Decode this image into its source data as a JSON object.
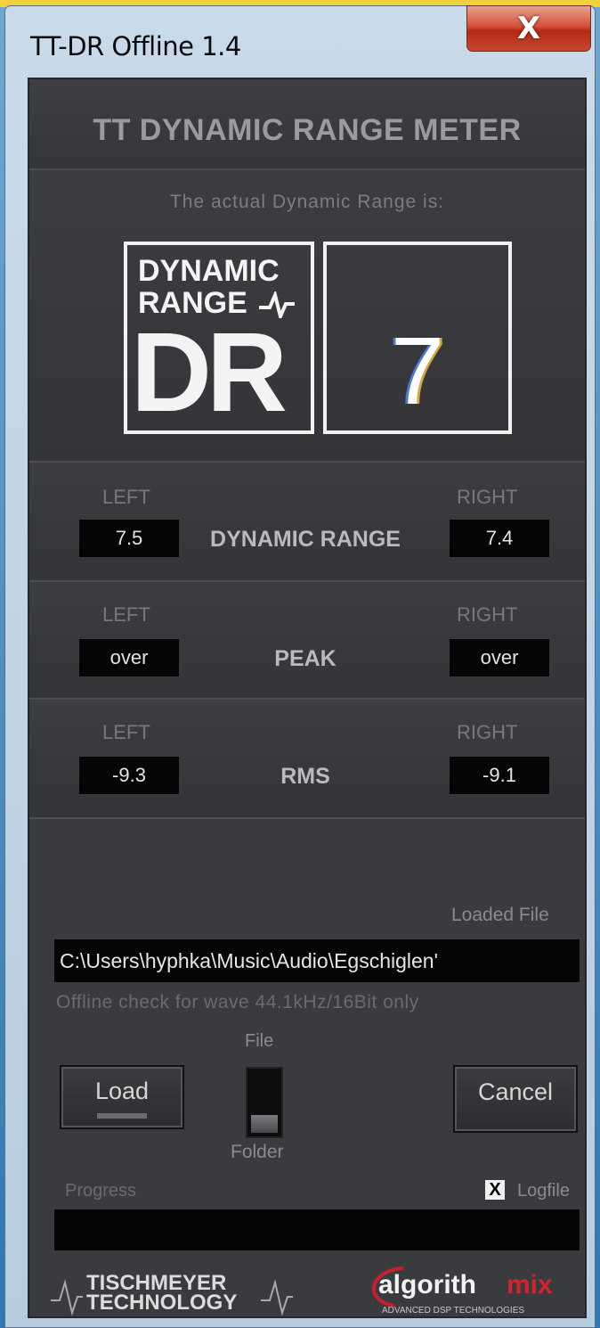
{
  "window": {
    "title": "TT-DR Offline 1.4",
    "close_label": "X"
  },
  "header": {
    "title": "TT DYNAMIC RANGE METER"
  },
  "dr": {
    "subtitle": "The actual Dynamic Range is:",
    "logo_line1": "DYNAMIC",
    "logo_line2": "RANGE",
    "logo_big": "DR",
    "value": "7"
  },
  "dynamic_range": {
    "left_label": "LEFT",
    "right_label": "RIGHT",
    "label": "DYNAMIC RANGE",
    "left": "7.5",
    "right": "7.4"
  },
  "peak": {
    "left_label": "LEFT",
    "right_label": "RIGHT",
    "label": "PEAK",
    "left": "over",
    "right": "over"
  },
  "rms": {
    "left_label": "LEFT",
    "right_label": "RIGHT",
    "label": "RMS",
    "left": "-9.3",
    "right": "-9.1"
  },
  "file": {
    "loaded_label": "Loaded File",
    "path": "C:\\Users\\hyphka\\Music\\Audio\\Egschiglen'",
    "note": "Offline check for wave 44.1kHz/16Bit only"
  },
  "controls": {
    "load_label": "Load",
    "cancel_label": "Cancel",
    "toggle_top": "File",
    "toggle_bottom": "Folder",
    "toggle_state": "Folder",
    "progress_label": "Progress",
    "progress": 0,
    "logfile_label": "Logfile",
    "logfile_checked": true,
    "check_mark": "X"
  },
  "footer": {
    "brand1_line1": "TISCHMEYER",
    "brand1_line2": "TECHNOLOGY",
    "brand2_a": "algorith",
    "brand2_b": "mix",
    "brand2_tagline": "ADVANCED DSP TECHNOLOGIES"
  }
}
